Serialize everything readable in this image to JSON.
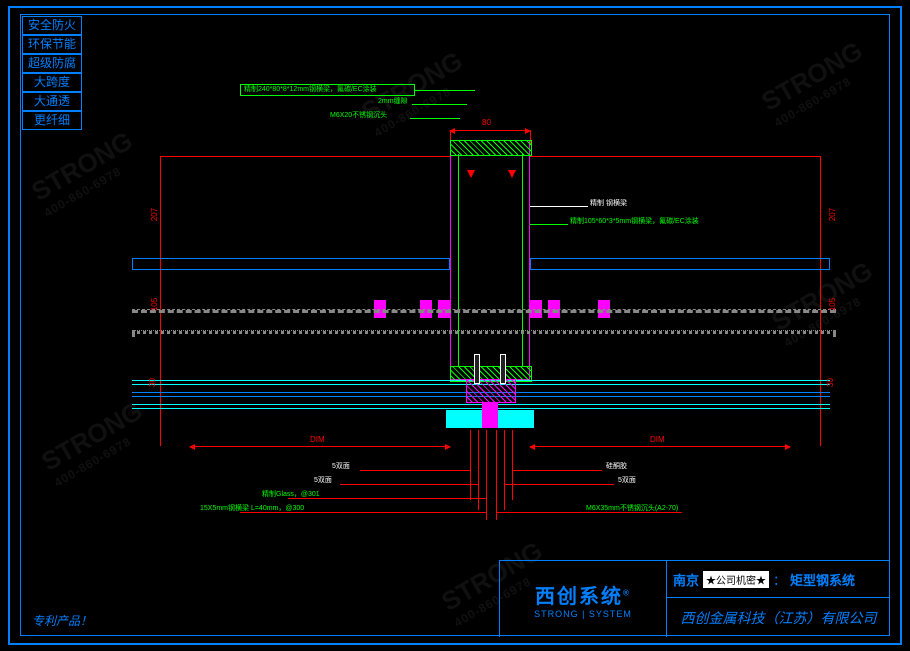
{
  "tags": [
    "安全防火",
    "环保节能",
    "超级防腐",
    "大跨度",
    "大通透",
    "更纤细"
  ],
  "title_block": {
    "brand": "西创系统",
    "brand_sup": "®",
    "strong": "STRONG | SYSTEM",
    "city": "南京",
    "confidential": "★公司机密★",
    "colon": "：",
    "system_name": "矩型钢系统",
    "company": "西创金属科技（江苏）有限公司"
  },
  "patent": "专利产品！",
  "watermark": {
    "big": "STRONG",
    "small": "400-860-6978"
  },
  "annotations": {
    "top1": "精制240*80*8*12mm钢横梁，氟碳/EC涂装",
    "top2": "2mm缝隙",
    "top3": "M6X20不锈钢沉头",
    "right1": "精制 钢横梁",
    "right2": "精制105*60*3*5mm钢横梁，氟碳/EC涂装",
    "btm_l1": "5双面",
    "btm_l2": "5双面",
    "btm_l3": "15X5mm钢横梁 L=40mm，@300",
    "btm_l4": "精制Glass，@301",
    "btm_r1": "硅酮胶",
    "btm_r2": "5双面",
    "btm_r3": "M6X35mm不锈钢沉头(A2-70)"
  },
  "dims": {
    "top_80": "80",
    "v_left": "207",
    "v_right": "207",
    "v_mid_l": "105",
    "v_mid_r": "105",
    "v_low_l": "30",
    "v_low_r": "30",
    "bot_l": "DIM",
    "bot_r": "DIM"
  }
}
